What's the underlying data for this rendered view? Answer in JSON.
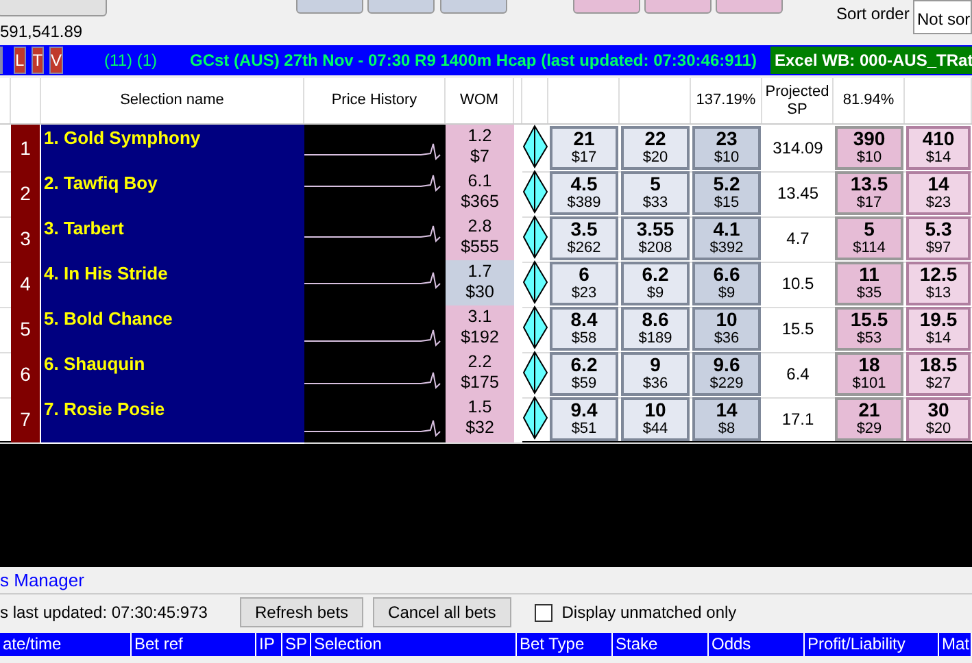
{
  "top": {
    "balance": "591,541.89",
    "sort_label": "Sort order",
    "sort_value": "Not sor"
  },
  "market_bar": {
    "buttons": [
      {
        "label": "L"
      },
      {
        "label": "T"
      },
      {
        "label": "V"
      }
    ],
    "counts": "(11) (1)",
    "title": "GCst (AUS) 27th Nov - 07:30 R9 1400m Hcap (last updated: 07:30:46:911)",
    "excel": "Excel WB: 000-AUS_TRat"
  },
  "columns": {
    "selection": "Selection name",
    "history": "Price History",
    "wom": "WOM",
    "back_book": "137.19%",
    "projected": "Projected SP",
    "lay_book": "81.94%"
  },
  "runners": [
    {
      "number": "1",
      "name": "1. Gold Symphony",
      "wom": {
        "price": "1.2",
        "amount": "$7",
        "color": "#e6bcd6"
      },
      "back": [
        [
          "21",
          "$17"
        ],
        [
          "22",
          "$20"
        ],
        [
          "23",
          "$10"
        ]
      ],
      "sp": "314.09",
      "lay": [
        [
          "390",
          "$10"
        ],
        [
          "410",
          "$14"
        ]
      ]
    },
    {
      "number": "2",
      "name": "2. Tawfiq Boy",
      "wom": {
        "price": "6.1",
        "amount": "$365",
        "color": "#e6bcd6"
      },
      "back": [
        [
          "4.5",
          "$389"
        ],
        [
          "5",
          "$33"
        ],
        [
          "5.2",
          "$15"
        ]
      ],
      "sp": "13.45",
      "lay": [
        [
          "13.5",
          "$17"
        ],
        [
          "14",
          "$23"
        ]
      ]
    },
    {
      "number": "3",
      "name": "3. Tarbert",
      "wom": {
        "price": "2.8",
        "amount": "$555",
        "color": "#e6bcd6"
      },
      "back": [
        [
          "3.5",
          "$262"
        ],
        [
          "3.55",
          "$208"
        ],
        [
          "4.1",
          "$392"
        ]
      ],
      "sp": "4.7",
      "lay": [
        [
          "5",
          "$114"
        ],
        [
          "5.3",
          "$97"
        ]
      ]
    },
    {
      "number": "4",
      "name": "4. In His Stride",
      "wom": {
        "price": "1.7",
        "amount": "$30",
        "color": "#c8d0e0"
      },
      "back": [
        [
          "6",
          "$23"
        ],
        [
          "6.2",
          "$9"
        ],
        [
          "6.6",
          "$9"
        ]
      ],
      "sp": "10.5",
      "lay": [
        [
          "11",
          "$35"
        ],
        [
          "12.5",
          "$13"
        ]
      ]
    },
    {
      "number": "5",
      "name": "5. Bold Chance",
      "wom": {
        "price": "3.1",
        "amount": "$192",
        "color": "#e6bcd6"
      },
      "back": [
        [
          "8.4",
          "$58"
        ],
        [
          "8.6",
          "$189"
        ],
        [
          "10",
          "$36"
        ]
      ],
      "sp": "15.5",
      "lay": [
        [
          "15.5",
          "$53"
        ],
        [
          "19.5",
          "$14"
        ]
      ]
    },
    {
      "number": "6",
      "name": "6. Shauquin",
      "wom": {
        "price": "2.2",
        "amount": "$175",
        "color": "#e6bcd6"
      },
      "back": [
        [
          "6.2",
          "$59"
        ],
        [
          "9",
          "$36"
        ],
        [
          "9.6",
          "$229"
        ]
      ],
      "sp": "6.4",
      "lay": [
        [
          "18",
          "$101"
        ],
        [
          "18.5",
          "$27"
        ]
      ]
    },
    {
      "number": "7",
      "name": "7. Rosie Posie",
      "wom": {
        "price": "1.5",
        "amount": "$32",
        "color": "#e6bcd6"
      },
      "back": [
        [
          "9.4",
          "$51"
        ],
        [
          "10",
          "$44"
        ],
        [
          "14",
          "$8"
        ]
      ],
      "sp": "17.1",
      "lay": [
        [
          "21",
          "$29"
        ],
        [
          "30",
          "$20"
        ]
      ]
    }
  ],
  "bets_manager": {
    "title": "s Manager",
    "updated": "s last updated: 07:30:45:973",
    "buttons": [
      "Refresh bets",
      "Cancel all bets"
    ],
    "unmatched_only": {
      "label": "Display unmatched only",
      "checked": false
    },
    "columns": [
      "ate/time",
      "Bet ref",
      "IP",
      "SP",
      "Selection",
      "Bet Type",
      "Stake",
      "Odds",
      "Profit/Liability",
      "Mat"
    ]
  }
}
